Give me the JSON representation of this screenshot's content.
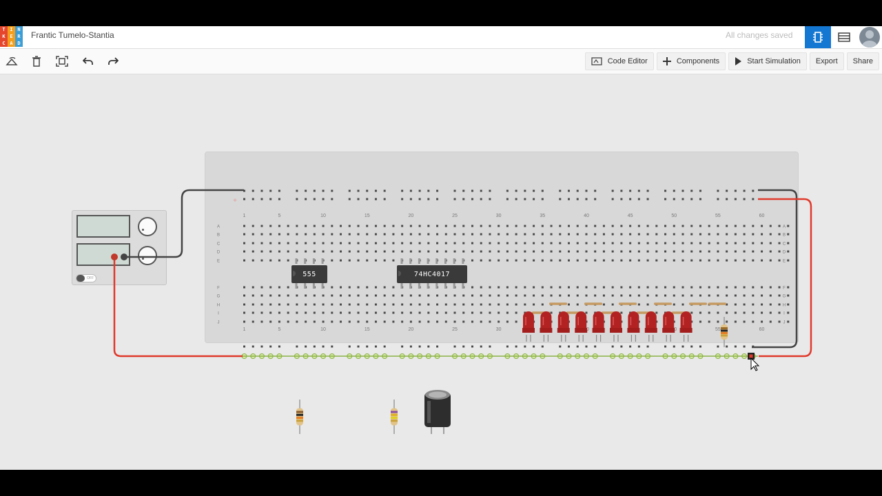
{
  "app": {
    "logo_letters": [
      "T",
      "I",
      "N",
      "K",
      "E",
      "R",
      "C",
      "A",
      "D"
    ],
    "logo_colors": [
      "#e5462e",
      "#f59e1b",
      "#3c9ed6",
      "#e5462e",
      "#f59e1b",
      "#3c9ed6",
      "#e5462e",
      "#f59e1b",
      "#3c9ed6"
    ],
    "title": "Frantic Tumelo-Stantia",
    "save_status": "All changes saved"
  },
  "toolbar": {
    "tools": [
      {
        "name": "rotate-icon"
      },
      {
        "name": "delete-icon"
      },
      {
        "name": "fit-view-icon"
      },
      {
        "name": "undo-icon"
      },
      {
        "name": "redo-icon"
      }
    ],
    "code_editor": "Code Editor",
    "components": "Components",
    "start_simulation": "Start Simulation",
    "export": "Export",
    "share": "Share"
  },
  "breadboard": {
    "column_numbers": [
      "1",
      "5",
      "10",
      "15",
      "20",
      "25",
      "30",
      "35",
      "40",
      "45",
      "50",
      "55",
      "60"
    ],
    "row_letters_top": [
      "A",
      "B",
      "C",
      "D",
      "E"
    ],
    "row_letters_bottom": [
      "F",
      "G",
      "H",
      "I",
      "J"
    ],
    "ics": [
      {
        "label": "555"
      },
      {
        "label": "74HC4017"
      }
    ],
    "led_count": 10
  },
  "power_supply": {
    "switch_label": "OFF"
  },
  "colors": {
    "accent": "#1477d1",
    "wire_red": "#e0392b",
    "wire_black": "#444444",
    "led": "#b32222"
  }
}
